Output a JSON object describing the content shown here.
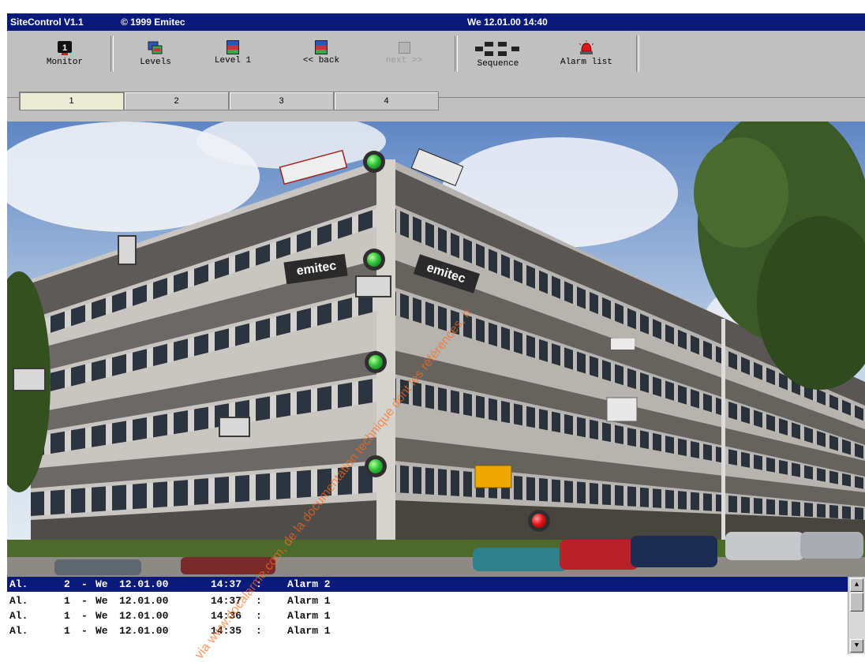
{
  "titlebar": {
    "app": "SiteControl V1.1",
    "copyright": "© 1999 Emitec",
    "datetime": "We 12.01.00  14:40"
  },
  "toolbar": {
    "monitor_badge": "1",
    "buttons": [
      {
        "label": "Monitor"
      },
      {
        "label": "Levels"
      },
      {
        "label": "Level 1"
      },
      {
        "label": "<< back"
      },
      {
        "label": "next >>"
      },
      {
        "label": "Sequence"
      },
      {
        "label": "Alarm list"
      }
    ]
  },
  "tabs": [
    "1",
    "2",
    "3",
    "4"
  ],
  "active_tab": "1",
  "building": {
    "signs": [
      "emitec",
      "emitec"
    ],
    "indicators": {
      "green_count": 4,
      "red_count": 1
    }
  },
  "alarm_log": [
    {
      "type": "Al.",
      "id": "2",
      "day": "We",
      "date": "12.01.00",
      "time": "14:37",
      "label": "Alarm 2",
      "selected": true
    },
    {
      "type": "Al.",
      "id": "1",
      "day": "We",
      "date": "12.01.00",
      "time": "14:37",
      "label": "Alarm 1",
      "selected": false
    },
    {
      "type": "Al.",
      "id": "1",
      "day": "We",
      "date": "12.01.00",
      "time": "14:36",
      "label": "Alarm 1",
      "selected": false
    },
    {
      "type": "Al.",
      "id": "1",
      "day": "We",
      "date": "12.01.00",
      "time": "14:35",
      "label": "Alarm 1",
      "selected": false
    }
  ],
  "watermark": "via www.docalarme.com, de la documentation technique dont les références, n",
  "colors": {
    "titlebar": "#0a1a7a",
    "panel": "#c0c0c0",
    "active_tab": "#ecebd4",
    "ok": "#2fc23a",
    "alarm": "#e01818"
  }
}
